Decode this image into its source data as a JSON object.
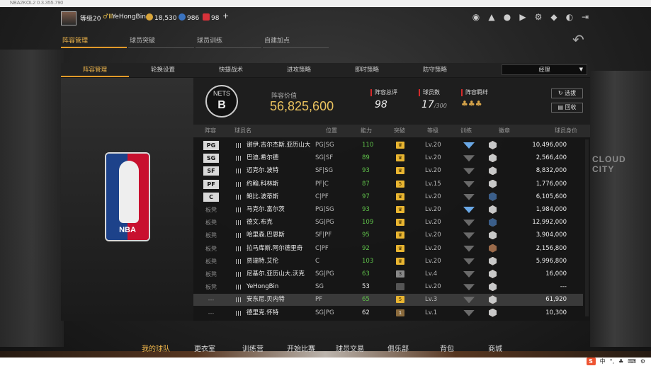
{
  "window_title": "NBA2KOL2 0.3.355.790",
  "topbar": {
    "level": "等级20",
    "vip": "♂Ⅲ",
    "username": "YeHongBin",
    "coins": "18,530",
    "points": "986",
    "tickets": "98",
    "plus": "+"
  },
  "main_tabs": [
    "阵容管理",
    "球员突破",
    "球员训练",
    "自建加点"
  ],
  "sub_tabs": [
    "阵容管理",
    "轮换设置",
    "快捷战术",
    "进攻策略",
    "即时策略",
    "防守策略"
  ],
  "coach_select": "经理",
  "team": {
    "lineup_value_label": "阵容价值",
    "lineup_value": "56,825,600",
    "rating_label": "阵容总评",
    "rating": "98",
    "players_label": "球员数",
    "players": "17",
    "players_max": "/300",
    "bond_label": "阵容羁绊",
    "select_btn": "选拔",
    "recycle_btn": "回收"
  },
  "table_headers": [
    "阵容",
    "球员名",
    "位置",
    "能力",
    "突破",
    "等级",
    "训练",
    "徽章",
    "球员身价"
  ],
  "rows": [
    {
      "slot": "PG",
      "starter": true,
      "name": "谢伊.吉尔杰斯.亚历山大",
      "pos": "PG|SG",
      "ovr": "110",
      "brk": "♛",
      "lvl": "Lv.20",
      "salary": "10,496,000"
    },
    {
      "slot": "SG",
      "starter": true,
      "name": "巴迪.希尔德",
      "pos": "SG|SF",
      "ovr": "89",
      "brk": "♛",
      "lvl": "Lv.20",
      "salary": "2,566,400"
    },
    {
      "slot": "SF",
      "starter": true,
      "name": "迈克尔.波特",
      "pos": "SF|SG",
      "ovr": "93",
      "brk": "♛",
      "lvl": "Lv.20",
      "salary": "8,832,000"
    },
    {
      "slot": "PF",
      "starter": true,
      "name": "约翰.科林斯",
      "pos": "PF|C",
      "ovr": "87",
      "brk": "5",
      "lvl": "Lv.15",
      "salary": "1,776,000"
    },
    {
      "slot": "C",
      "starter": true,
      "name": "鲍比.波蒂斯",
      "pos": "C|PF",
      "ovr": "97",
      "brk": "♛",
      "lvl": "Lv.20",
      "salary": "6,105,600"
    },
    {
      "slot": "板凳",
      "starter": false,
      "name": "马克尔.富尔茨",
      "pos": "PG|SG",
      "ovr": "93",
      "brk": "♛",
      "lvl": "Lv.20",
      "salary": "1,984,000"
    },
    {
      "slot": "板凳",
      "starter": false,
      "name": "德文.布克",
      "pos": "SG|PG",
      "ovr": "109",
      "brk": "♛",
      "lvl": "Lv.20",
      "salary": "12,992,000"
    },
    {
      "slot": "板凳",
      "starter": false,
      "name": "哈里森.巴恩斯",
      "pos": "SF|PF",
      "ovr": "95",
      "brk": "♛",
      "lvl": "Lv.20",
      "salary": "3,904,000"
    },
    {
      "slot": "板凳",
      "starter": false,
      "name": "拉马库斯.阿尔德里奇",
      "pos": "C|PF",
      "ovr": "92",
      "brk": "♛",
      "lvl": "Lv.20",
      "salary": "2,156,800"
    },
    {
      "slot": "板凳",
      "starter": false,
      "name": "贾瑞特.艾伦",
      "pos": "C",
      "ovr": "103",
      "brk": "♛",
      "lvl": "Lv.20",
      "salary": "5,996,800"
    },
    {
      "slot": "板凳",
      "starter": false,
      "name": "尼基尔.亚历山大.沃克",
      "pos": "SG|PG",
      "ovr": "63",
      "brk": "3",
      "lvl": "Lv.4",
      "salary": "16,000"
    },
    {
      "slot": "板凳",
      "starter": false,
      "name": "YeHongBin",
      "pos": "SG",
      "ovr": "53",
      "brk": "",
      "lvl": "Lv.20",
      "salary": "---"
    },
    {
      "slot": "---",
      "starter": false,
      "name": "安东尼.贝内特",
      "pos": "PF",
      "ovr": "65",
      "brk": "5",
      "lvl": "Lv.3",
      "salary": "61,920"
    },
    {
      "slot": "---",
      "starter": false,
      "name": "德里克.怀特",
      "pos": "SG|PG",
      "ovr": "62",
      "brk": "1",
      "lvl": "Lv.1",
      "salary": "10,300"
    }
  ],
  "bottom_menu": [
    "我的球队",
    "更衣室",
    "训练营",
    "开始比赛",
    "球员交易",
    "俱乐部",
    "背包",
    "商城"
  ],
  "bg_text": "CLOUD CITY",
  "team_logo_text": "NETS",
  "nba_logo_text": "NBA",
  "ime": [
    "S",
    "中",
    "°,",
    "♣",
    "⌨",
    "⚙"
  ]
}
